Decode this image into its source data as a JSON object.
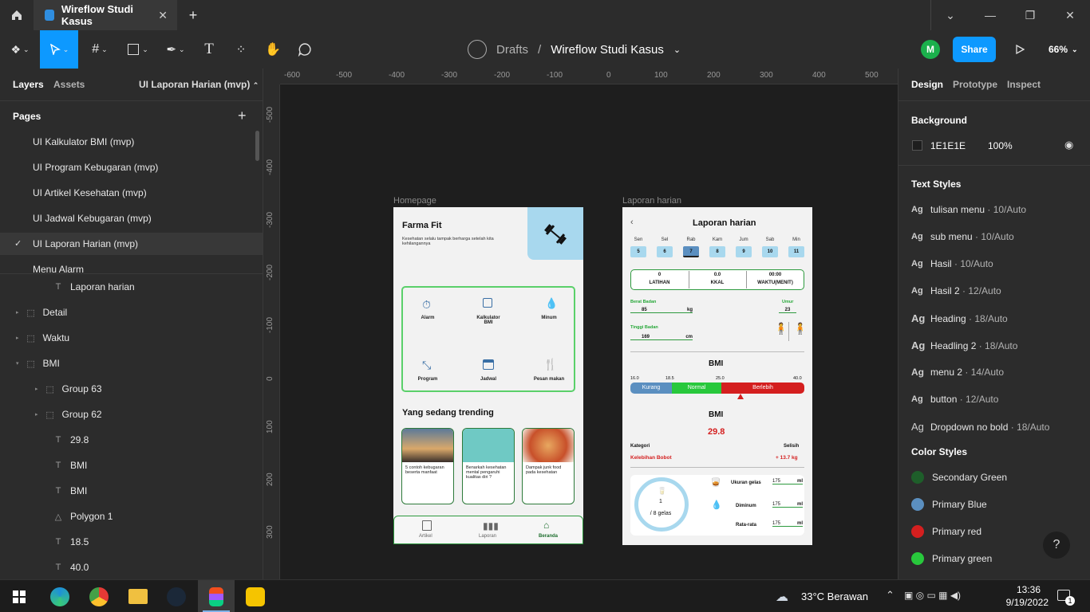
{
  "app": {
    "tab_title": "Wireflow Studi Kasus"
  },
  "toolbar": {
    "breadcrumb_drafts": "Drafts",
    "breadcrumb_sep": "/",
    "file_name": "Wireflow Studi Kasus",
    "avatar_initial": "M",
    "share_label": "Share",
    "zoom": "66%"
  },
  "left": {
    "tab_layers": "Layers",
    "tab_assets": "Assets",
    "current_page": "UI Laporan Harian (mvp)",
    "pages_header": "Pages",
    "pages": [
      "UI Kalkulator BMI (mvp)",
      "UI Program Kebugaran (mvp)",
      "UI Artikel Kesehatan (mvp)",
      "UI Jadwal Kebugaran (mvp)",
      "UI Laporan Harian (mvp)",
      "Menu Alarm"
    ],
    "layers": [
      {
        "label": "Laporan harian",
        "icon": "T"
      },
      {
        "label": "Detail",
        "icon": "frame"
      },
      {
        "label": "Waktu",
        "icon": "frame"
      },
      {
        "label": "BMI",
        "icon": "frame"
      },
      {
        "label": "Group 63",
        "icon": "frame"
      },
      {
        "label": "Group 62",
        "icon": "frame"
      },
      {
        "label": "29.8",
        "icon": "T"
      },
      {
        "label": "BMI",
        "icon": "T"
      },
      {
        "label": "BMI",
        "icon": "T"
      },
      {
        "label": "Polygon 1",
        "icon": "polygon"
      },
      {
        "label": "18.5",
        "icon": "T"
      },
      {
        "label": "40.0",
        "icon": "T"
      }
    ]
  },
  "right": {
    "tab_design": "Design",
    "tab_prototype": "Prototype",
    "tab_inspect": "Inspect",
    "background_label": "Background",
    "bg_hex": "1E1E1E",
    "bg_opacity": "100%",
    "text_styles_label": "Text Styles",
    "text_styles": [
      {
        "ag": "Ag",
        "name": "tulisan menu",
        "spec": " · 10/Auto"
      },
      {
        "ag": "Ag",
        "name": "sub menu",
        "spec": " · 10/Auto"
      },
      {
        "ag": "Ag",
        "name": "Hasil",
        "spec": " · 10/Auto"
      },
      {
        "ag": "Ag",
        "name": "Hasil 2",
        "spec": " · 12/Auto"
      },
      {
        "ag": "Ag",
        "name": "Heading",
        "spec": " · 18/Auto"
      },
      {
        "ag": "Ag",
        "name": "Headling 2",
        "spec": " · 18/Auto"
      },
      {
        "ag": "Ag",
        "name": "menu 2",
        "spec": " · 14/Auto"
      },
      {
        "ag": "Ag",
        "name": "button",
        "spec": " · 12/Auto"
      },
      {
        "ag": "Ag",
        "name": "Dropdown no bold",
        "spec": " · 18/Auto"
      }
    ],
    "color_styles_label": "Color Styles",
    "color_styles": [
      {
        "name": "Secondary Green",
        "color": "#1e5e2a"
      },
      {
        "name": "Primary Blue",
        "color": "#5b8fc0"
      },
      {
        "name": "Primary red",
        "color": "#d41f1f"
      },
      {
        "name": "Primary green",
        "color": "#28c83c"
      }
    ],
    "help": "?"
  },
  "ruler": {
    "h": [
      "-600",
      "-500",
      "-400",
      "-300",
      "-200",
      "-100",
      "0",
      "100",
      "200",
      "300",
      "400",
      "500"
    ],
    "v": [
      "-500",
      "-400",
      "-300",
      "-200",
      "-100",
      "0",
      "100",
      "200",
      "300"
    ]
  },
  "frames": {
    "home_label": "Homepage",
    "laporan_label": "Laporan harian",
    "home": {
      "title": "Farma Fit",
      "subtitle": "Kesehatan selalu tampak berharga setelah kita kehilangannya",
      "menu": [
        "Alarm",
        "Kalkulator BMI",
        "Minum",
        "Program",
        "Jadwal",
        "Pesan makan"
      ],
      "trending": "Yang sedang trending",
      "cards": [
        "5 contoh kebugaran beserta manfaat",
        "Benarkah kesehatan mental pengaruhi kualitas diri ?",
        "Dampak junk food pada kesehatan"
      ],
      "nav": [
        "Artikel",
        "Laporan",
        "Beranda"
      ]
    },
    "laporan": {
      "title": "Laporan harian",
      "days": [
        "Sen",
        "Sel",
        "Rab",
        "Kam",
        "Jum",
        "Sab",
        "Min"
      ],
      "dates": [
        "5",
        "6",
        "7",
        "8",
        "9",
        "10",
        "11"
      ],
      "stats": [
        {
          "v": "0",
          "l": "LATIHAN"
        },
        {
          "v": "0.0",
          "l": "KKAL"
        },
        {
          "v": "00:00",
          "l": "WAKTU(MENIT)"
        }
      ],
      "berat_label": "Berat Badan",
      "berat_val": "85",
      "berat_unit": "kg",
      "umur_label": "Umur",
      "umur_val": "23",
      "tinggi_label": "Tinggi Badan",
      "tinggi_val": "169",
      "tinggi_unit": "cm",
      "bmi_title": "BMI",
      "scale": [
        "16.0",
        "18.5",
        "25.0",
        "40.0"
      ],
      "bands": [
        "Kurang",
        "Normal",
        "Berlebih"
      ],
      "bmi_label2": "BMI",
      "bmi_value": "29.8",
      "kategori_label": "Kategori",
      "kategori_val": "Kelebihan Bobot",
      "selisih_label": "Selisih",
      "selisih_val": "+ 13.7 kg",
      "gelas_count": "1",
      "gelas_total": "/ 8 gelas",
      "water": [
        {
          "l": "Ukuran gelas",
          "v": "175",
          "u": "ml"
        },
        {
          "l": "Diminum",
          "v": "175",
          "u": "ml"
        },
        {
          "l": "Rata-rata",
          "v": "175",
          "u": "ml"
        }
      ]
    }
  },
  "taskbar": {
    "weather": "33°C  Berawan",
    "time": "13:36",
    "date": "9/19/2022",
    "notif": "1"
  }
}
